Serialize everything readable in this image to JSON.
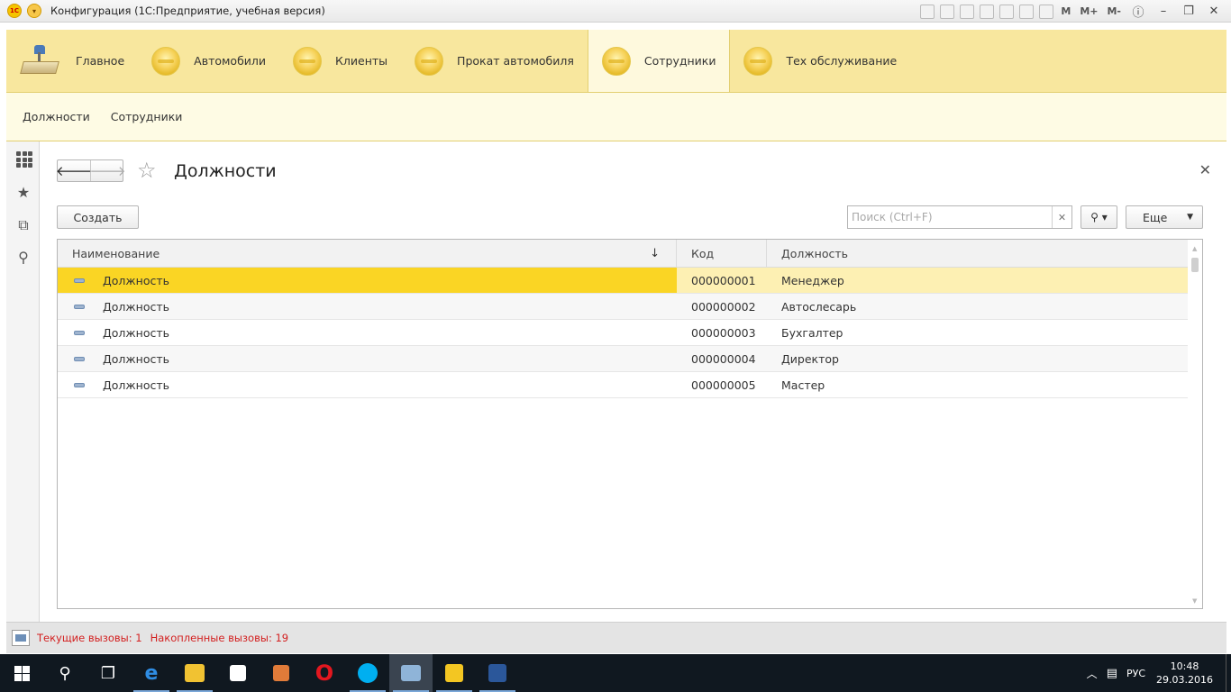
{
  "window": {
    "title": "Конфигурация  (1С:Предприятие, учебная версия)",
    "logo_text": "1С",
    "toolbar_labels": [
      "M",
      "M+",
      "M-"
    ]
  },
  "sections": [
    {
      "label": "Главное",
      "icon": "desk-lamp-icon"
    },
    {
      "label": "Автомобили",
      "icon": "section-circle-icon"
    },
    {
      "label": "Клиенты",
      "icon": "section-circle-icon"
    },
    {
      "label": "Прокат автомобиля",
      "icon": "section-circle-icon"
    },
    {
      "label": "Сотрудники",
      "icon": "section-circle-icon",
      "active": true
    },
    {
      "label": "Тех обслуживание",
      "icon": "section-circle-icon"
    }
  ],
  "subsections": [
    "Должности",
    "Сотрудники"
  ],
  "form": {
    "title": "Должности",
    "create_label": "Создать",
    "search_placeholder": "Поиск (Ctrl+F)",
    "more_label": "Еще",
    "columns": [
      "Наименование",
      "Код",
      "Должность"
    ],
    "rows": [
      {
        "name": "Должность",
        "code": "000000001",
        "position": "Менеджер",
        "selected": true
      },
      {
        "name": "Должность",
        "code": "000000002",
        "position": "Автослесарь"
      },
      {
        "name": "Должность",
        "code": "000000003",
        "position": "Бухгалтер"
      },
      {
        "name": "Должность",
        "code": "000000004",
        "position": "Директор"
      },
      {
        "name": "Должность",
        "code": "000000005",
        "position": "Мастер"
      }
    ]
  },
  "status": {
    "current_calls": "Текущие вызовы: 1",
    "accumulated_calls": "Накопленные вызовы: 19"
  },
  "taskbar": {
    "lang": "РУС",
    "time": "10:48",
    "date": "29.03.2016"
  },
  "colors": {
    "sections_bg": "#f8e79e",
    "selected_row": "#fad524",
    "status_text": "#d32020"
  }
}
